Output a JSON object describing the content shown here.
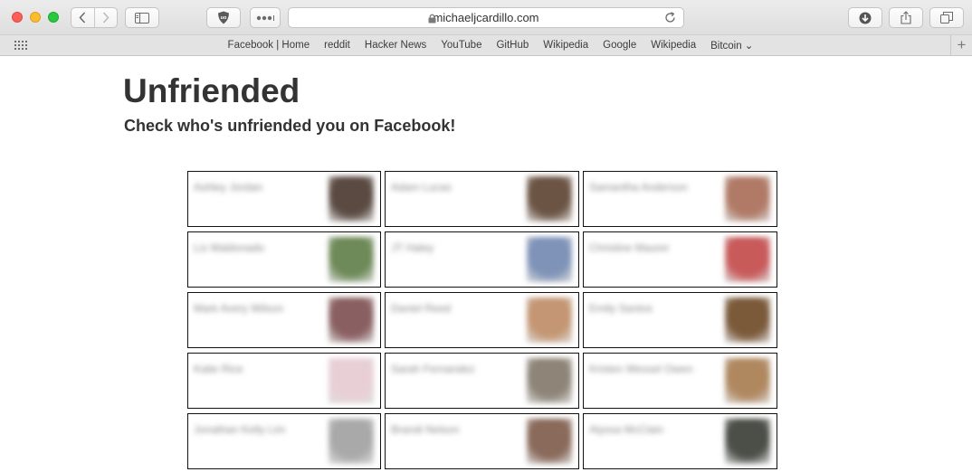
{
  "browser": {
    "url": "michaeljcardillo.com",
    "favorites": [
      "Facebook | Home",
      "reddit",
      "Hacker News",
      "YouTube",
      "GitHub",
      "Wikipedia",
      "Google",
      "Wikipedia",
      "Bitcoin ⌄"
    ]
  },
  "page": {
    "title": "Unfriended",
    "subtitle": "Check who's unfriended you on Facebook!"
  },
  "friends": [
    {
      "name": "Ashley Jordan",
      "photo_color": "#5a4a42"
    },
    {
      "name": "Adam Lucas",
      "photo_color": "#6b5443"
    },
    {
      "name": "Samantha Anderson",
      "photo_color": "#b07a66"
    },
    {
      "name": "Liz Maldonado",
      "photo_color": "#6e8a58"
    },
    {
      "name": "JT Haley",
      "photo_color": "#7f93b8"
    },
    {
      "name": "Christine Maurer",
      "photo_color": "#c85a5a"
    },
    {
      "name": "Mark Avery Wilson",
      "photo_color": "#8a5f61"
    },
    {
      "name": "Daniel Reed",
      "photo_color": "#c49673"
    },
    {
      "name": "Emily Santos",
      "photo_color": "#7b5a3a"
    },
    {
      "name": "Katie Rice",
      "photo_color": "#e8cfd5"
    },
    {
      "name": "Sarah Fernandez",
      "photo_color": "#8e8578"
    },
    {
      "name": "Kristen Wessel Owen",
      "photo_color": "#b08860"
    },
    {
      "name": "Jonathan Kelly Lim",
      "photo_color": "#a9a9a9"
    },
    {
      "name": "Brandi Nelson",
      "photo_color": "#8a6a5a"
    },
    {
      "name": "Alyssa McClain",
      "photo_color": "#4b4f48"
    }
  ]
}
